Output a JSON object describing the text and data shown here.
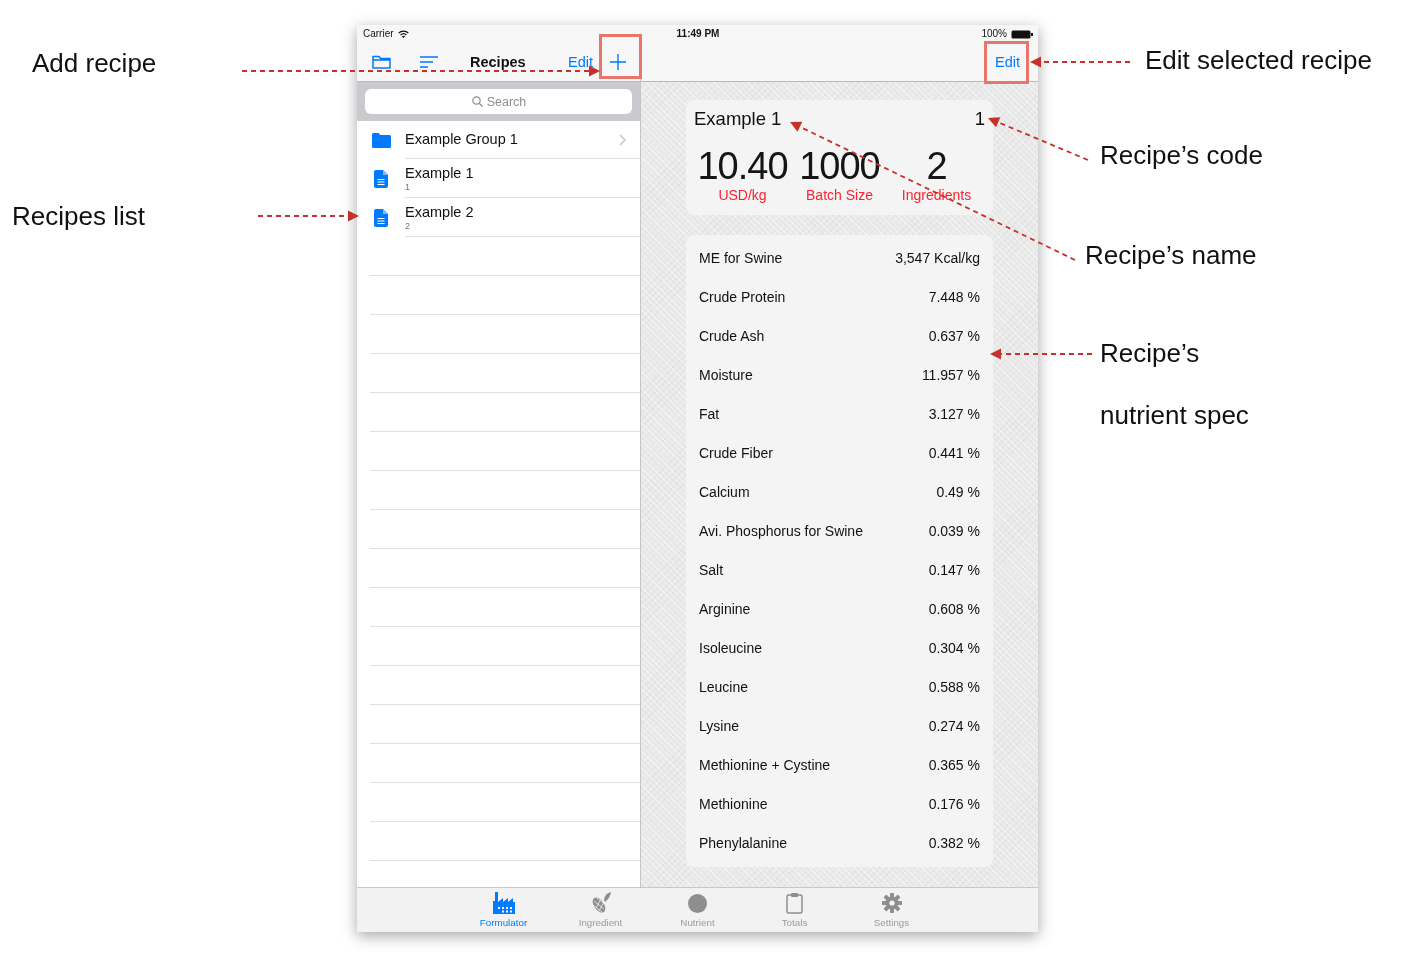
{
  "status_bar": {
    "carrier": "Carrier",
    "time": "11:49 PM",
    "battery": "100%"
  },
  "recipes_pane": {
    "title": "Recipes",
    "edit_button": {
      "label": "Edit"
    },
    "add_button": {
      "highlighted": true
    },
    "search": {
      "placeholder": "Search"
    },
    "items": [
      {
        "kind": "group",
        "title": "Example Group 1"
      },
      {
        "kind": "recipe",
        "title": "Example 1",
        "code": "1"
      },
      {
        "kind": "recipe",
        "title": "Example 2",
        "code": "2"
      }
    ]
  },
  "detail_pane": {
    "edit_button": {
      "label": "Edit",
      "highlighted": true
    },
    "recipe": {
      "name": "Example 1",
      "code": "1",
      "stats": [
        {
          "value": "10.40",
          "label": "USD/kg"
        },
        {
          "value": "1000",
          "label": "Batch Size"
        },
        {
          "value": "2",
          "label": "Ingredients"
        }
      ]
    },
    "nutrients": [
      {
        "name": "ME for Swine",
        "value": "3,547 Kcal/kg"
      },
      {
        "name": "Crude Protein",
        "value": "7.448 %"
      },
      {
        "name": "Crude Ash",
        "value": "0.637 %"
      },
      {
        "name": "Moisture",
        "value": "11.957 %"
      },
      {
        "name": "Fat",
        "value": "3.127 %"
      },
      {
        "name": "Crude Fiber",
        "value": "0.441 %"
      },
      {
        "name": "Calcium",
        "value": "0.49 %"
      },
      {
        "name": "Avi. Phosphorus for Swine",
        "value": "0.039 %"
      },
      {
        "name": "Salt",
        "value": "0.147 %"
      },
      {
        "name": "Arginine",
        "value": "0.608 %"
      },
      {
        "name": "Isoleucine",
        "value": "0.304 %"
      },
      {
        "name": "Leucine",
        "value": "0.588 %"
      },
      {
        "name": "Lysine",
        "value": "0.274 %"
      },
      {
        "name": "Methionine + Cystine",
        "value": "0.365 %"
      },
      {
        "name": "Methionine",
        "value": "0.176 %"
      },
      {
        "name": "Phenylalanine",
        "value": "0.382 %"
      }
    ]
  },
  "tab_bar": {
    "items": [
      {
        "label": "Formulator",
        "selected": true
      },
      {
        "label": "Ingredient",
        "selected": false
      },
      {
        "label": "Nutrient",
        "selected": false
      },
      {
        "label": "Totals",
        "selected": false
      },
      {
        "label": "Settings",
        "selected": false
      }
    ]
  },
  "annotations": [
    {
      "text": "Add recipe"
    },
    {
      "text": "Edit selected recipe"
    },
    {
      "text": "Recipe’s code"
    },
    {
      "text": "Recipes list"
    },
    {
      "text": "Recipe’s name"
    },
    {
      "text": "Recipe’s nutrient spec"
    }
  ]
}
